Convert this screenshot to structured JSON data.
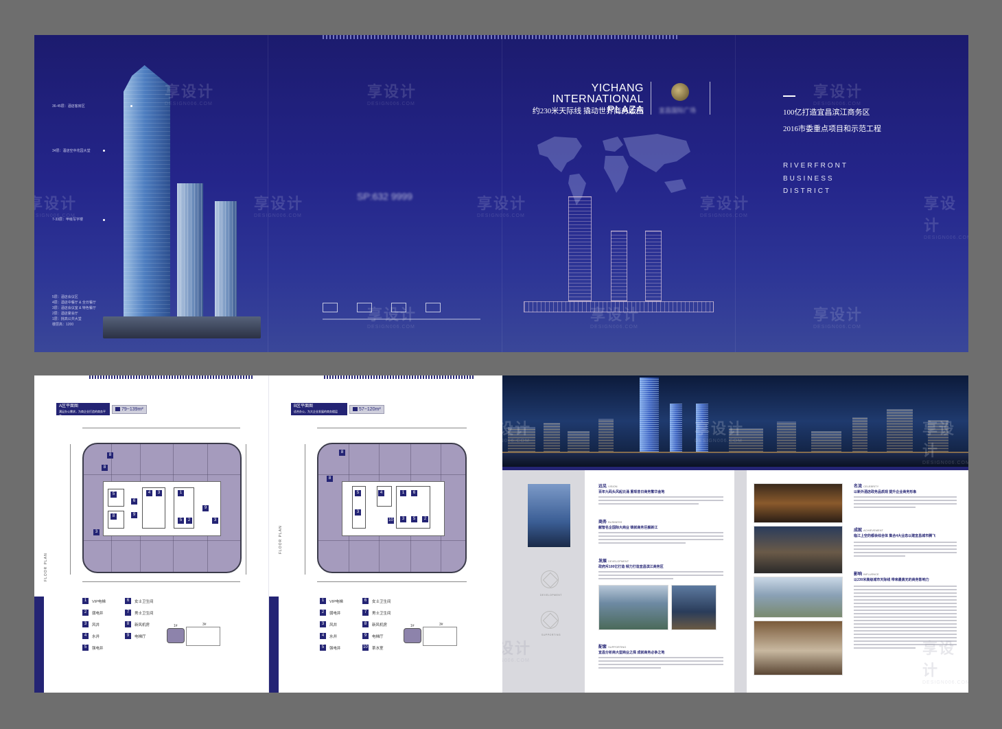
{
  "cover": {
    "title_en_line1": "YICHANG",
    "title_en_line2": "INTERNATIONAL PLAZA",
    "title_cn": "约230米天际线 撬动世界商务版图",
    "right_line1": "100亿打造宜昌滨江商务区",
    "right_line2": "2016市委重点项目和示范工程",
    "riverfront": "RIVERFRONT",
    "business": "BUSINESS",
    "district": "DISTRICT",
    "phone_blurred": "SP:632 9999",
    "logo_text_blurred": "宜昌国际广场"
  },
  "floors": [
    {
      "label": "36-45层：酒店客房区"
    },
    {
      "label": "34层：酒店空中花园大堂"
    },
    {
      "label": "7-33层：甲级写字楼"
    },
    {
      "label": "5层：酒店会议区"
    },
    {
      "label": "4层：酒店中餐厅 & 全日餐厅"
    },
    {
      "label": "3层：酒店会议室 & 特色餐厅"
    },
    {
      "label": "2层：酒店宴会厅"
    },
    {
      "label": "1层：挑高公共大堂"
    },
    {
      "label": "楼层高：1200"
    }
  ],
  "watermark": {
    "cn": "享设计",
    "en": "DESIGN006.COM"
  },
  "planA": {
    "tag_title": "A区平面图",
    "tag_sub": "满足办公需求，为商企业打造的商务平台",
    "area": "79~139m²",
    "side_label": "FLOOR PLAN",
    "legend": [
      {
        "num": "1",
        "label": "VIP电梯"
      },
      {
        "num": "2",
        "label": "弱电井"
      },
      {
        "num": "3",
        "label": "风井"
      },
      {
        "num": "4",
        "label": "水井"
      },
      {
        "num": "5",
        "label": "强电井"
      },
      {
        "num": "6",
        "label": "女士卫生间"
      },
      {
        "num": "7",
        "label": "男士卫生间"
      },
      {
        "num": "8",
        "label": "新风机房"
      },
      {
        "num": "9",
        "label": "电梯厅"
      }
    ],
    "key_1": "1#",
    "key_3": "3#"
  },
  "planB": {
    "tag_title": "B区平面图",
    "tag_sub": "适合办公，为大企业发展的商务楼层",
    "area": "57~120m²",
    "side_label": "FLOOR PLAN",
    "legend": [
      {
        "num": "1",
        "label": "VIP电梯"
      },
      {
        "num": "2",
        "label": "弱电井"
      },
      {
        "num": "3",
        "label": "风井"
      },
      {
        "num": "4",
        "label": "水井"
      },
      {
        "num": "5",
        "label": "强电井"
      },
      {
        "num": "6",
        "label": "女士卫生间"
      },
      {
        "num": "7",
        "label": "男士卫生间"
      },
      {
        "num": "8",
        "label": "新风机房"
      },
      {
        "num": "9",
        "label": "电梯厅"
      },
      {
        "num": "10",
        "label": "茶水室"
      }
    ],
    "key_1": "1#",
    "key_3": "3#"
  },
  "features": {
    "sections": [
      {
        "head": "远见",
        "en": "VISION",
        "sub": "百年九码头风起云涌 重现昔日商务繁华金地"
      },
      {
        "head": "商务",
        "en": "BUSINESS",
        "sub": "献智名企国际大商业 铸就商务巨舰新江"
      },
      {
        "head": "发展",
        "en": "DEVELOPMENT",
        "sub": "政府斥100亿打造 倾力打造宜昌滨江商务区"
      },
      {
        "head": "配套",
        "en": "SUPPORTING",
        "sub": "宜昌分析商大型商业之择 成就商务必争之地"
      }
    ],
    "right_sections": [
      {
        "head": "名流",
        "en": "CELEBRITY",
        "sub": "以新外酒店政务品质观 提升企业商务形象"
      },
      {
        "head": "成就",
        "en": "ACHIEVEMENT",
        "sub": "临江上空的都会综合体 集合4大业态以建宜昌城市腾飞"
      },
      {
        "head": "影响",
        "en": "INFLUENCE",
        "sub": "以230米高级城市天际线 带来最高无的商务影响力"
      }
    ],
    "emblem_1": "DEVELOPMENT",
    "emblem_2": "SUPPORTING"
  }
}
